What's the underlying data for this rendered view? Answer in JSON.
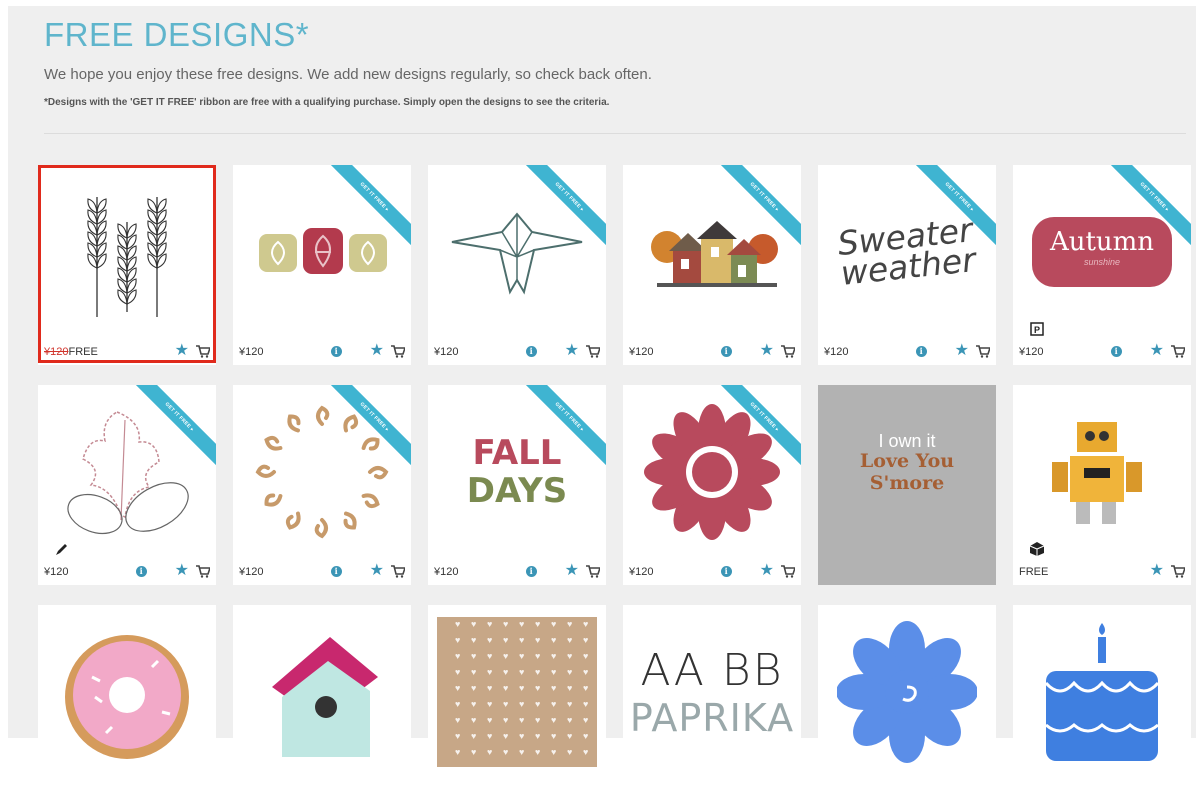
{
  "header": {
    "title": "FREE DESIGNS*",
    "subtitle": "We hope you enjoy these free designs. We add new designs regularly, so check back often.",
    "note": "*Designs with the 'GET IT FREE' ribbon are free with a qualifying purchase. Simply open the designs to see the criteria."
  },
  "colors": {
    "accent": "#5fb5cc",
    "ribbon": "#3fb4d1",
    "icon": "#3b95b6",
    "selected_outline": "#e02a1c"
  },
  "ribbon_text": "GET IT FREE ▸",
  "designs": [
    {
      "name": "wheat-stalks",
      "price": "¥120",
      "sale": "FREE",
      "ribbon": false,
      "info": false,
      "feature": null,
      "selected": true
    },
    {
      "name": "leaf-tiles",
      "price": "¥120",
      "ribbon": true,
      "info": true,
      "feature": null
    },
    {
      "name": "geometric-bird",
      "price": "¥120",
      "ribbon": true,
      "info": true,
      "feature": null
    },
    {
      "name": "autumn-houses",
      "price": "¥120",
      "ribbon": true,
      "info": true,
      "feature": null
    },
    {
      "name": "sweater-weather",
      "price": "¥120",
      "ribbon": true,
      "info": true,
      "feature": null,
      "art_text": "Sweater weather"
    },
    {
      "name": "autumn-label",
      "price": "¥120",
      "ribbon": true,
      "info": true,
      "feature": "print-then-cut-icon",
      "art_text": "Autumn",
      "art_subtext": "sunshine"
    },
    {
      "name": "oak-leaf",
      "price": "¥120",
      "ribbon": true,
      "info": true,
      "feature": "pen-icon"
    },
    {
      "name": "swirl-wreath",
      "price": "¥120",
      "ribbon": true,
      "info": true,
      "feature": null
    },
    {
      "name": "fall-days",
      "price": "¥120",
      "ribbon": true,
      "info": true,
      "feature": null,
      "art_text": "FALL DAYS"
    },
    {
      "name": "flower-mandala",
      "price": "¥120",
      "ribbon": true,
      "info": true,
      "feature": null
    },
    {
      "name": "smore-owned",
      "price": "",
      "ribbon": false,
      "info": false,
      "feature": null,
      "owned": true,
      "owned_label": "I own it",
      "art_text": "Love You S'more"
    },
    {
      "name": "robot-3d",
      "price": "FREE",
      "ribbon": false,
      "info": false,
      "feature": "3d-box-icon"
    },
    {
      "name": "donut",
      "price": "",
      "ribbon": false,
      "info": false,
      "feature": null,
      "partial": true
    },
    {
      "name": "birdhouse",
      "price": "",
      "ribbon": false,
      "info": false,
      "feature": null,
      "partial": true
    },
    {
      "name": "heart-pattern",
      "price": "",
      "ribbon": false,
      "info": false,
      "feature": null,
      "partial": true
    },
    {
      "name": "paprika-font",
      "price": "",
      "ribbon": false,
      "info": false,
      "feature": null,
      "partial": true,
      "art_text": "AA BB",
      "art_subtext": "PAPRIKA"
    },
    {
      "name": "blue-flower",
      "price": "",
      "ribbon": false,
      "info": false,
      "feature": null,
      "partial": true
    },
    {
      "name": "birthday-cake",
      "price": "",
      "ribbon": false,
      "info": false,
      "feature": null,
      "partial": true
    }
  ]
}
